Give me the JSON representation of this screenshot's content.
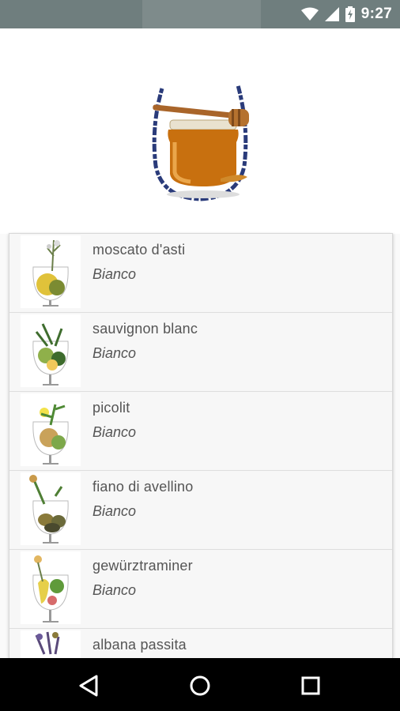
{
  "status_bar": {
    "time": "9:27",
    "icons": [
      "wifi-icon",
      "signal-icon",
      "battery-charging-icon"
    ]
  },
  "header": {
    "image": "honey-jar-in-wine-glass-icon"
  },
  "wines": [
    {
      "name": "moscato d'asti",
      "type": "Bianco"
    },
    {
      "name": "sauvignon blanc",
      "type": "Bianco"
    },
    {
      "name": "picolit",
      "type": "Bianco"
    },
    {
      "name": "fiano di avellino",
      "type": "Bianco"
    },
    {
      "name": "gewürztraminer",
      "type": "Bianco"
    },
    {
      "name": "albana passita",
      "type": ""
    }
  ],
  "nav_bar": {
    "buttons": [
      "back-icon",
      "home-icon",
      "recents-icon"
    ]
  },
  "colors": {
    "status_bar": "#6f7e7e",
    "nav_bar": "#000000",
    "list_background": "#f7f7f7",
    "honey": "#c8700f"
  }
}
